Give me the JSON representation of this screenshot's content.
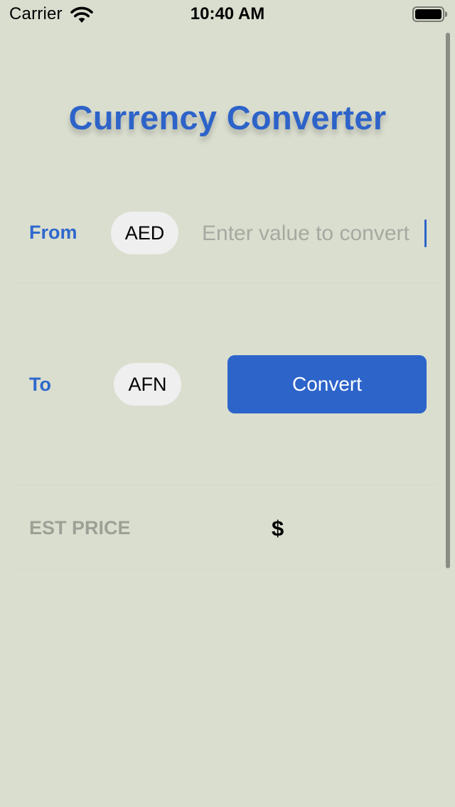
{
  "status_bar": {
    "carrier": "Carrier",
    "time": "10:40 AM",
    "icons": [
      "wifi-icon",
      "battery-icon"
    ]
  },
  "title": "Currency Converter",
  "from": {
    "label": "From",
    "currency": "AED",
    "input_value": "",
    "input_placeholder": "Enter value to convert"
  },
  "to": {
    "label": "To",
    "currency": "AFN"
  },
  "convert_button": {
    "label": "Convert"
  },
  "estimate": {
    "label": "EST PRICE",
    "currency_symbol": "$",
    "value": ""
  },
  "colors": {
    "background": "#dadecf",
    "accent": "#2d63c9",
    "pill_background": "#efefef",
    "muted_text": "#9da096"
  }
}
